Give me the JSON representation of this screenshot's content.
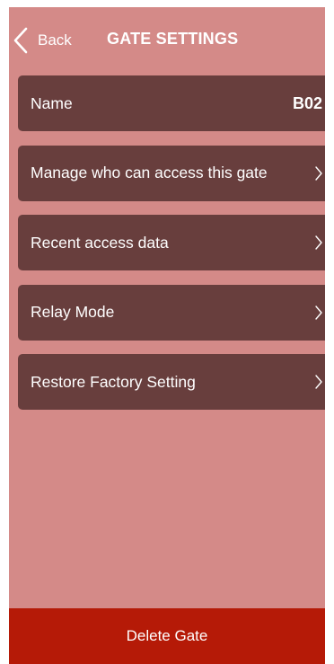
{
  "header": {
    "back_label": "Back",
    "title": "GATE SETTINGS",
    "back_icon": "chevron-left-icon"
  },
  "menu": {
    "items": [
      {
        "label": "Name",
        "value": "B02"
      },
      {
        "label": "Manage who can access this gate",
        "icon": "chevron-right-icon"
      },
      {
        "label": "Recent access data",
        "icon": "chevron-right-icon"
      },
      {
        "label": "Relay Mode",
        "icon": "chevron-right-icon"
      },
      {
        "label": "Restore Factory Setting",
        "icon": "chevron-right-icon"
      }
    ]
  },
  "footer": {
    "delete_label": "Delete Gate"
  },
  "colors": {
    "background": "#d48a88",
    "row_background": "#683e3d",
    "delete_background": "#b51a07",
    "text": "#ffffff"
  }
}
